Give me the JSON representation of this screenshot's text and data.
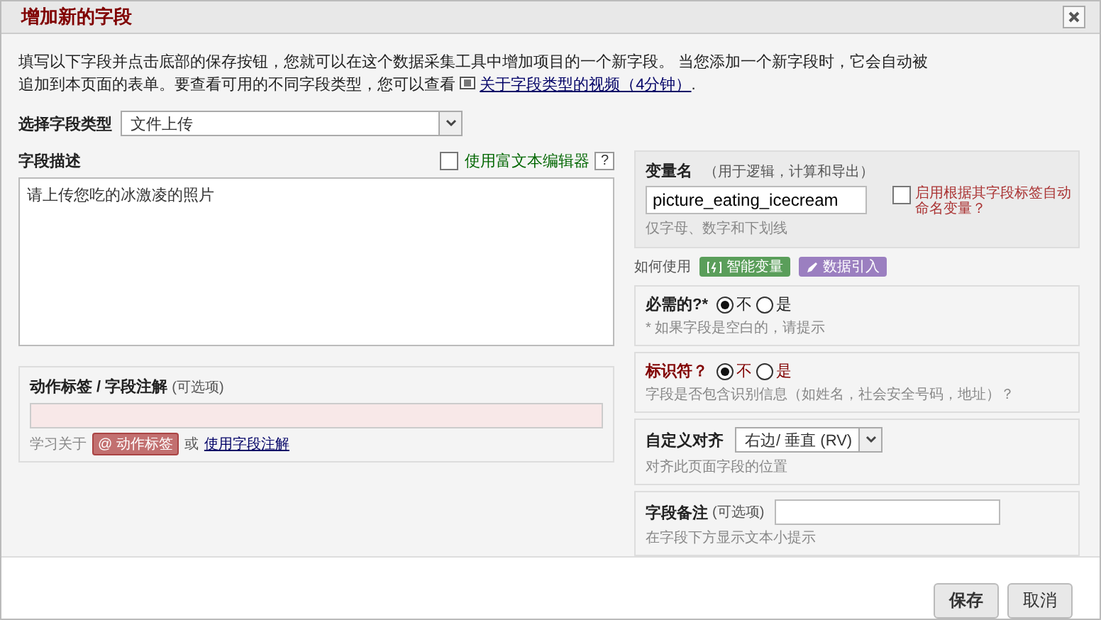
{
  "dialog": {
    "title": "增加新的字段"
  },
  "intro": {
    "text": "填写以下字段并点击底部的保存按钮，您就可以在这个数据采集工具中增加项目的一个新字段。 当您添加一个新字段时，它会自动被追加到本页面的表单。要查看可用的不同字段类型，您可以查看",
    "link": "关于字段类型的视频（4分钟）",
    "after": "."
  },
  "field_type": {
    "label": "选择字段类型",
    "value": "文件上传"
  },
  "description": {
    "label": "字段描述",
    "rich_text": {
      "label": "使用富文本编辑器",
      "checked": false
    },
    "help": "?",
    "value": "请上传您吃的冰激凌的照片"
  },
  "action_tags": {
    "label": "动作标签 / 字段注解",
    "optional": "(可选项)",
    "learn": "学习关于",
    "tag": "@ 动作标签",
    "or": "或",
    "link": "使用字段注解"
  },
  "variable": {
    "label": "变量名",
    "hint": "（用于逻辑，计算和导出）",
    "value": "picture_eating_icecream",
    "note": "仅字母、数字和下划线",
    "auto_name": {
      "label": "启用根据其字段标签自动命名变量？",
      "checked": false
    }
  },
  "how_to_use": {
    "label": "如何使用",
    "buttons": [
      {
        "kind": "smart",
        "label": "智能变量",
        "color": "#5a9e5a"
      },
      {
        "kind": "piping",
        "label": "数据引入",
        "color": "#9b7fc0"
      }
    ]
  },
  "required": {
    "label": "必需的?*",
    "options": [
      {
        "label": "不",
        "selected": true
      },
      {
        "label": "是",
        "selected": false
      }
    ],
    "note": "* 如果字段是空白的，请提示"
  },
  "identifier": {
    "label": "标识符？",
    "options": [
      {
        "label": "不",
        "selected": true
      },
      {
        "label": "是",
        "selected": false
      }
    ],
    "note": "字段是否包含识别信息（如姓名，社会安全号码，地址）？"
  },
  "alignment": {
    "label": "自定义对齐",
    "value": "右边/ 垂直 (RV)",
    "note": "对齐此页面字段的位置"
  },
  "field_note": {
    "label": "字段备注",
    "optional": "(可选项)",
    "note": "在字段下方显示文本小提示"
  },
  "buttons": [
    {
      "label": "保存"
    },
    {
      "label": "取消"
    }
  ]
}
